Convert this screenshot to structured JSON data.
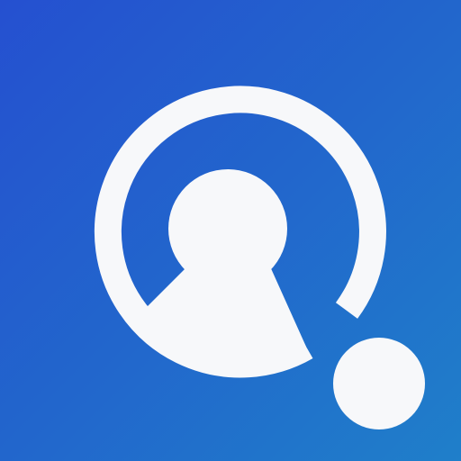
{
  "icon": {
    "name": "user-search-logo",
    "colors": {
      "background_start": "#2550d0",
      "background_mid": "#2266cc",
      "background_end": "#1f7fca",
      "foreground": "#f7f8fa"
    }
  }
}
